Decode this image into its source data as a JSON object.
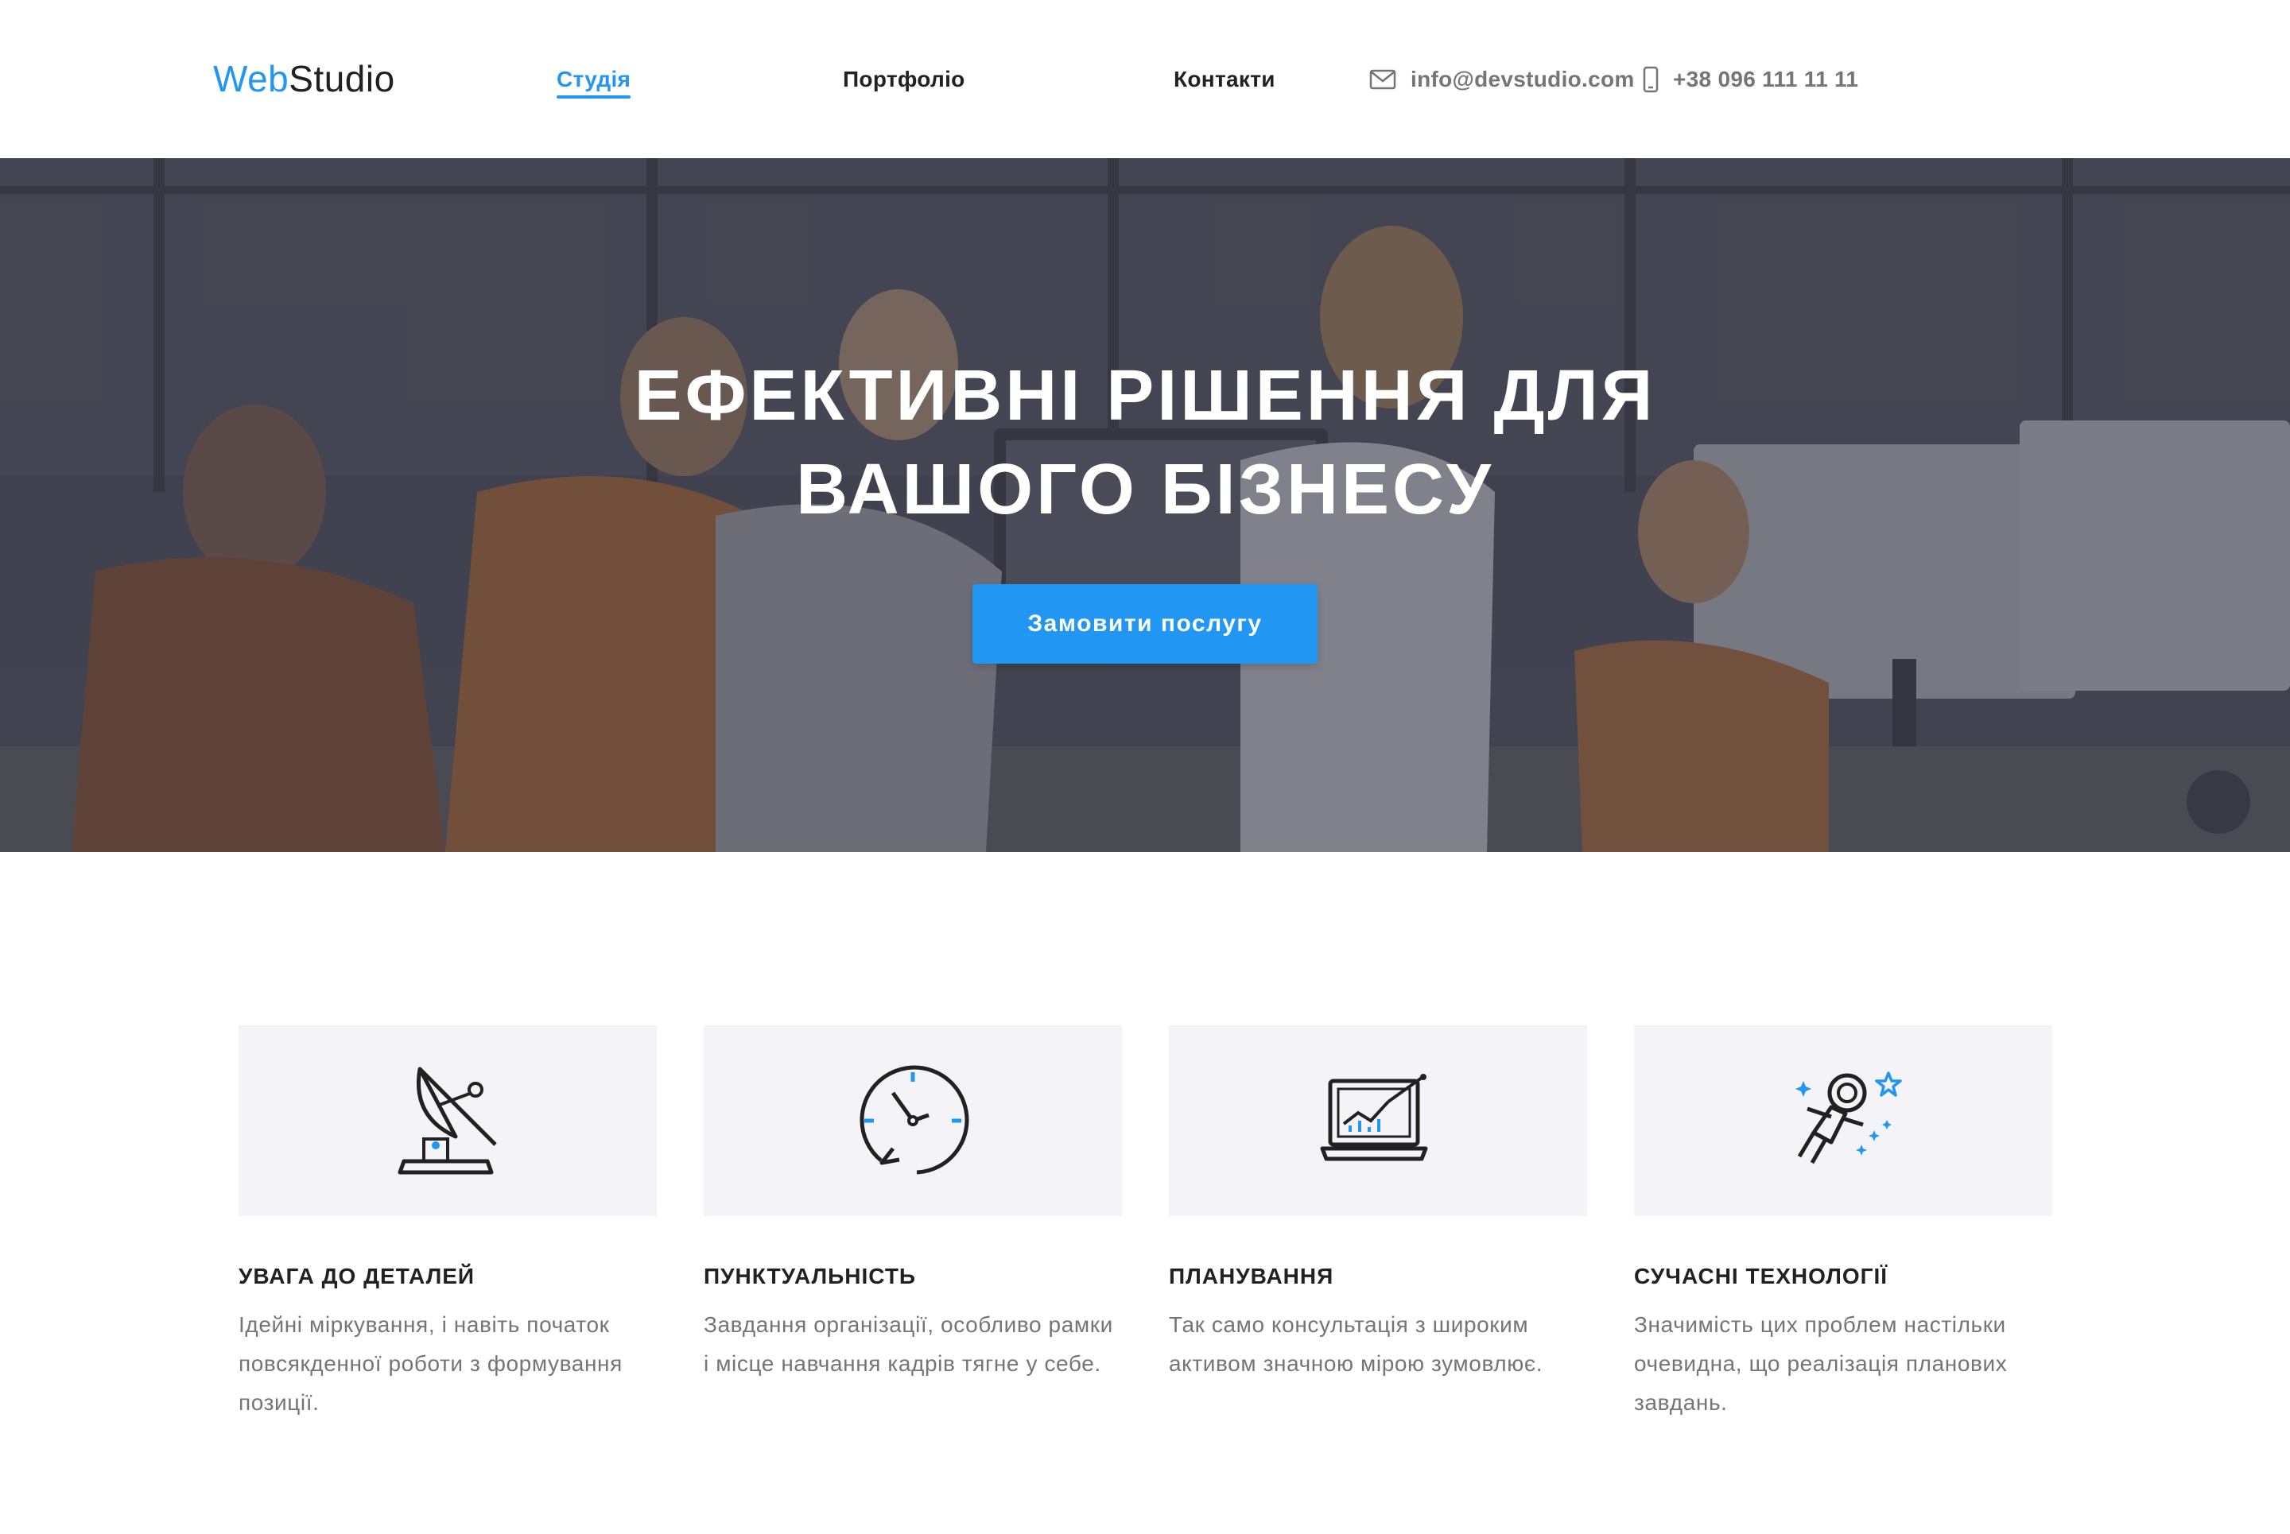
{
  "header": {
    "logo": {
      "part1": "Web",
      "part2": "Studio"
    },
    "nav": [
      {
        "label": "Студія",
        "active": true
      },
      {
        "label": "Портфоліо",
        "active": false
      },
      {
        "label": "Контакти",
        "active": false
      }
    ],
    "email": "info@devstudio.com",
    "phone": "+38 096 111 11 11"
  },
  "hero": {
    "title_line1": "Ефективні рішення для",
    "title_line2": "вашого бізнесу",
    "button_label": "Замовити послугу"
  },
  "features": [
    {
      "icon": "satellite-dish-icon",
      "title": "Увага до деталей",
      "text": "Ідейні міркування, і навіть початок повсякденної роботи з формування позиції."
    },
    {
      "icon": "clock-icon",
      "title": "Пунктуальність",
      "text": "Завдання організації, особливо рамки і місце навчання кадрів тягне у себе."
    },
    {
      "icon": "laptop-chart-icon",
      "title": "Планування",
      "text": "Так само консультація з широким активом значною мірою зумовлює."
    },
    {
      "icon": "astronaut-icon",
      "title": "Сучасні технології",
      "text": "Значимість цих проблем настільки очевидна, що реалізація планових завдань."
    }
  ],
  "colors": {
    "accent": "#2196f3",
    "text": "#212121",
    "muted": "#757575",
    "card_bg": "#f4f4f8"
  }
}
